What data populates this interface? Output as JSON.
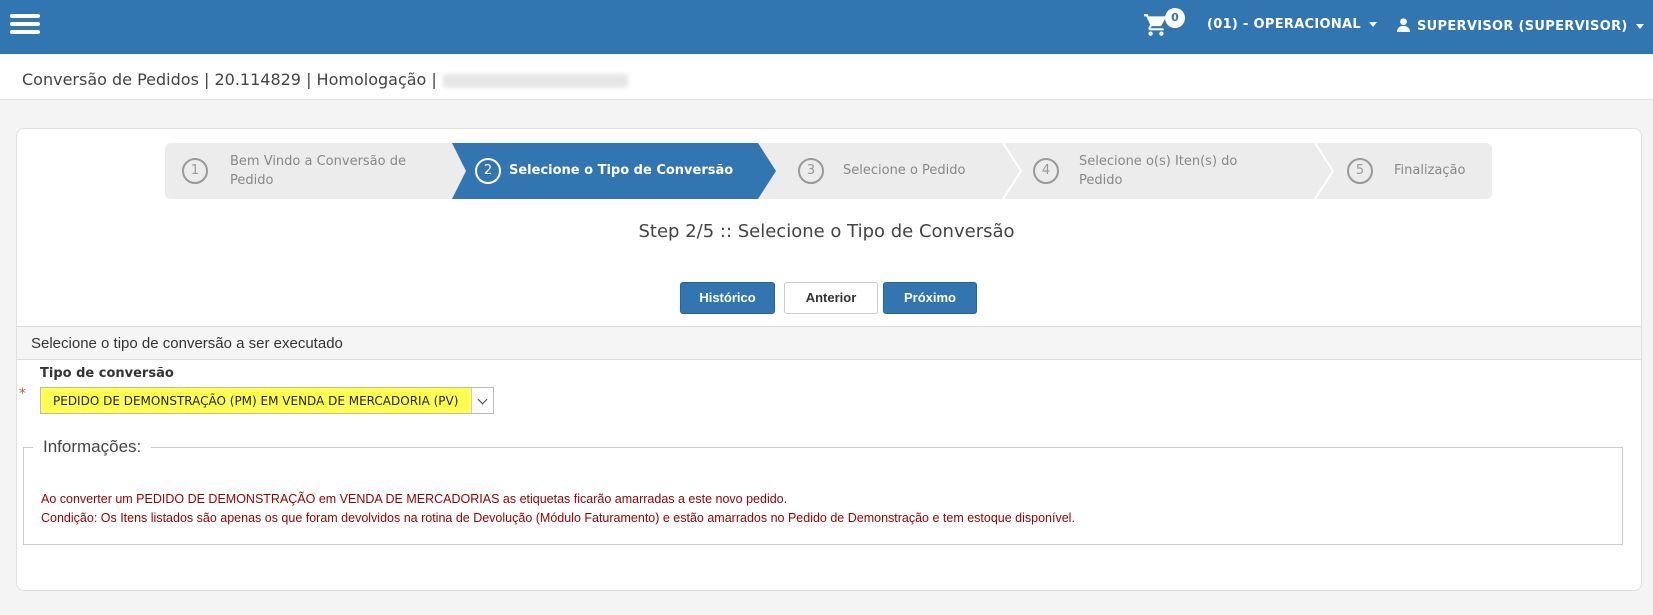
{
  "topbar": {
    "menu_icon": "hamburger-icon",
    "cart_icon": "shopping-cart-icon",
    "cart_count": "0",
    "company": "(01) - OPERACIONAL",
    "user_icon": "user-icon",
    "user": "SUPERVISOR (SUPERVISOR)"
  },
  "breadcrumb": {
    "text": "Conversão de Pedidos | 20.114829 | Homologação |"
  },
  "wizard": {
    "steps": [
      {
        "num": "1",
        "label": "Bem Vindo a Conversão de Pedido",
        "active": false
      },
      {
        "num": "2",
        "label": "Selecione o Tipo de Conversão",
        "active": true
      },
      {
        "num": "3",
        "label": "Selecione o Pedido",
        "active": false
      },
      {
        "num": "4",
        "label": "Selecione o(s) Iten(s) do Pedido",
        "active": false
      },
      {
        "num": "5",
        "label": "Finalização",
        "active": false
      }
    ],
    "title": "Step 2/5 :: Selecione o Tipo de Conversão"
  },
  "buttons": {
    "historico": "Histórico",
    "anterior": "Anterior",
    "proximo": "Próximo"
  },
  "section": {
    "header": "Selecione o tipo de conversão a ser executado",
    "field_label": "Tipo de conversão",
    "required_mark": "*",
    "selected_value": "PEDIDO DE DEMONSTRAÇÃO (PM) EM VENDA DE MERCADORIA (PV)"
  },
  "info": {
    "legend": "Informações:",
    "line1": "Ao converter um PEDIDO DE DEMONSTRAÇÃO em VENDA DE MERCADORIAS as etiquetas ficarão amarradas a este novo pedido.",
    "line2": "Condição: Os Itens listados são apenas os que foram devolvidos na rotina de Devolução (Módulo Faturamento) e estão amarrados no Pedido de Demonstração e tem estoque disponível."
  },
  "colors": {
    "brand": "#3276b1",
    "select_highlight": "#ffff4d",
    "info_text": "#990000"
  }
}
